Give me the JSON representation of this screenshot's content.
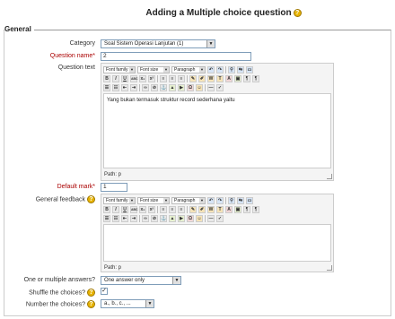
{
  "page": {
    "title": "Adding a Multiple choice question"
  },
  "general": {
    "legend": "General",
    "category_label": "Category",
    "category_value": "Soal Sistem Operasi Lanjutan (1)",
    "question_name_label": "Question name*",
    "question_name_value": "2",
    "question_text_label": "Question text",
    "question_text_content": "Yang bukan termasuk struktur record sederhana yaitu",
    "path_label_1": "Path: p",
    "default_mark_label": "Default mark*",
    "default_mark_value": "1",
    "general_feedback_label": "General feedback",
    "path_label_2": "Path: p",
    "one_or_multiple_label": "One or multiple answers?",
    "one_or_multiple_value": "One answer only",
    "shuffle_label": "Shuffle the choices?",
    "shuffle_checked": "✓",
    "number_choices_label": "Number the choices?",
    "number_choices_value": "a., b., c., ..."
  },
  "editor": {
    "font_family": "Font family",
    "font_size": "Font size",
    "paragraph": "Paragraph",
    "bold": "B",
    "italic": "I",
    "underline": "U",
    "strike": "ABC",
    "sub": "x₂",
    "sup": "x²",
    "omega": "Ω"
  },
  "colors": {
    "required": "#aa0000",
    "help": "#e8b400"
  },
  "icons": [
    "help-icon",
    "dropdown-arrow-icon",
    "resize-grip-icon"
  ]
}
